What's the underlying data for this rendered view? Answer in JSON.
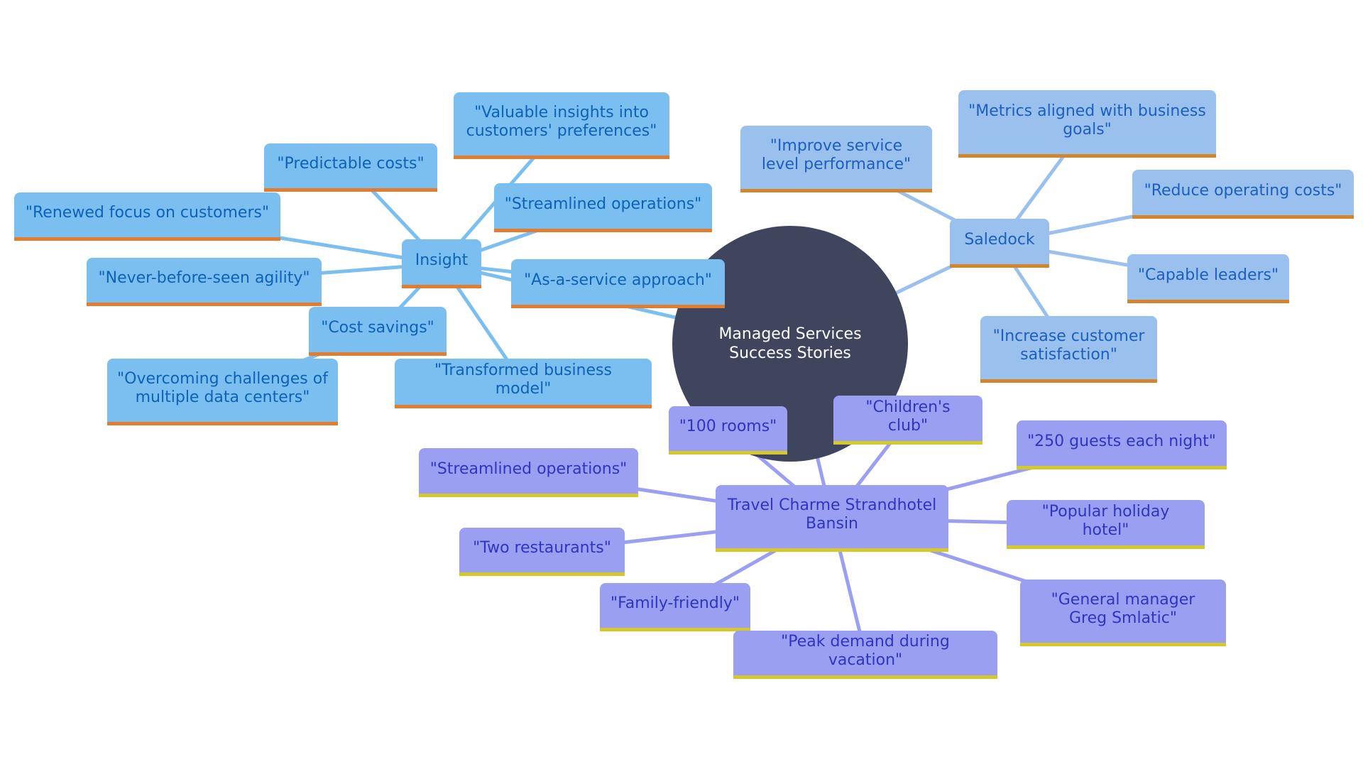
{
  "title": "Managed Services Success Stories",
  "colors": {
    "root_fill": "#40455e",
    "insight_fill": "#7abff0",
    "insight_edge": "#7abff0",
    "saledock_fill": "#9ac1ee",
    "saledock_edge": "#9ac1ee",
    "hotel_fill": "#9b9ff1",
    "hotel_edge": "#9b9ff1"
  },
  "branches": [
    {
      "id": "insight",
      "label": "Insight",
      "children": [
        "\"Valuable insights into customers' preferences\"",
        "\"Predictable costs\"",
        "\"Streamlined operations\"",
        "\"Renewed focus on customers\"",
        "\"Never-before-seen agility\"",
        "\"As-a-service approach\"",
        "\"Cost savings\"",
        "\"Overcoming challenges of multiple data centers\"",
        "\"Transformed business model\""
      ]
    },
    {
      "id": "saledock",
      "label": "Saledock",
      "children": [
        "\"Metrics aligned with business goals\"",
        "\"Improve service level performance\"",
        "\"Reduce operating costs\"",
        "\"Capable leaders\"",
        "\"Increase customer satisfaction\""
      ]
    },
    {
      "id": "hotel",
      "label": "Travel Charme Strandhotel Bansin",
      "children": [
        "\"100 rooms\"",
        "\"Children's club\"",
        "\"250 guests each night\"",
        "\"Streamlined operations\"",
        "\"Popular holiday hotel\"",
        "\"Two restaurants\"",
        "\"General manager Greg Smlatic\"",
        "\"Family-friendly\"",
        "\"Peak demand during vacation\""
      ]
    }
  ]
}
